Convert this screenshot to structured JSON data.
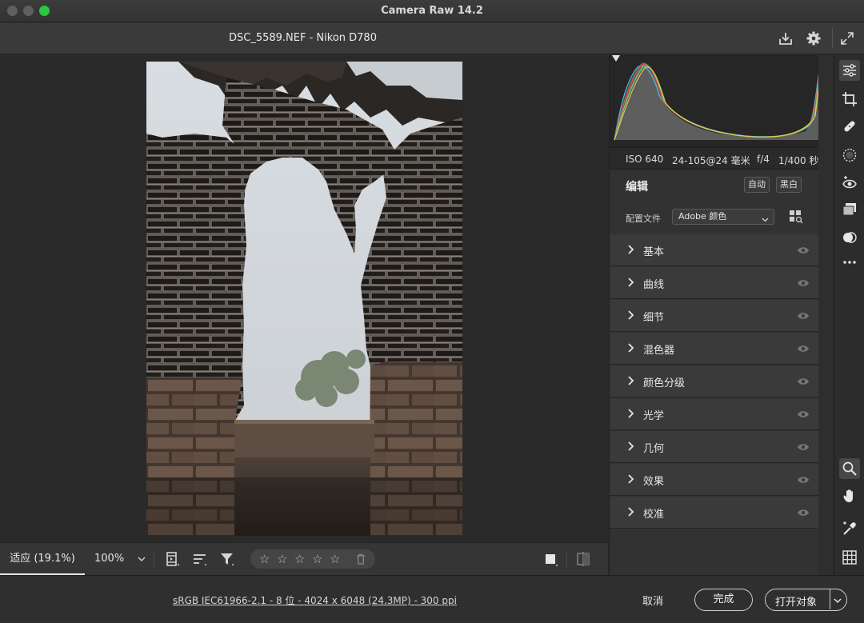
{
  "window": {
    "title": "Camera Raw 14.2"
  },
  "file": {
    "name": "DSC_5589.NEF -  Nikon D780"
  },
  "toolbar_icons": [
    "save-icon",
    "gear-icon",
    "fullscreen-icon"
  ],
  "exif": {
    "iso": "ISO 640",
    "lens": "24-105@24 毫米",
    "aperture": "f/4",
    "shutter": "1/400 秒"
  },
  "edit_panel": {
    "title": "编辑",
    "auto_label": "自动",
    "bw_label": "黑白",
    "profile_label": "配置文件",
    "profile_value": "Adobe 颜色"
  },
  "sections": [
    {
      "label": "基本"
    },
    {
      "label": "曲线"
    },
    {
      "label": "细节"
    },
    {
      "label": "混色器"
    },
    {
      "label": "颜色分级"
    },
    {
      "label": "光学"
    },
    {
      "label": "几何"
    },
    {
      "label": "效果"
    },
    {
      "label": "校准"
    }
  ],
  "bottom_toolbar": {
    "zoom_fit": "适应 (19.1%)",
    "zoom_100": "100%",
    "stars": [
      "☆",
      "☆",
      "☆",
      "☆",
      "☆"
    ]
  },
  "footer": {
    "info": "sRGB IEC61966-2.1 - 8 位 - 4024 x 6048 (24.3MP) - 300 ppi",
    "cancel": "取消",
    "done": "完成",
    "open": "打开对象"
  },
  "colors": {
    "accent_green": "#27c93f",
    "panel": "#3a3a3a",
    "background": "#2b2b2b"
  }
}
